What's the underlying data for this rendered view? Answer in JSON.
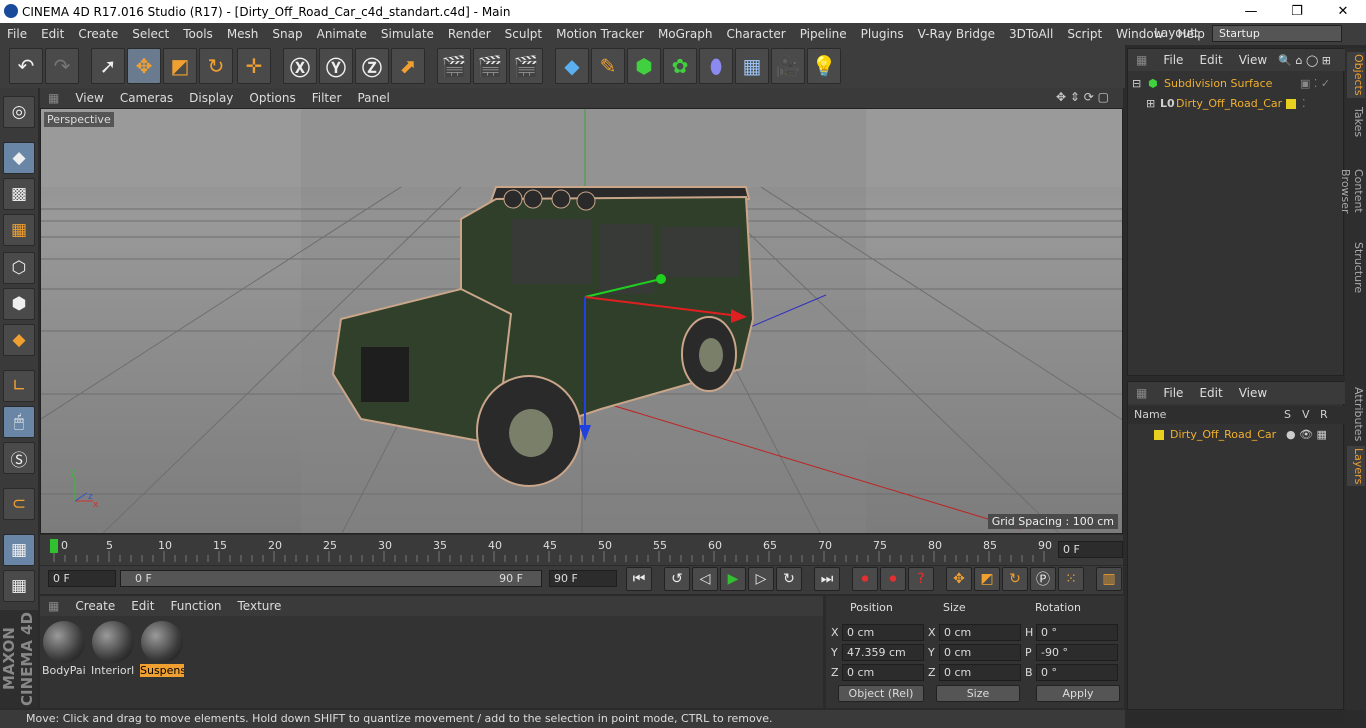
{
  "window": {
    "title": "CINEMA 4D R17.016 Studio (R17) - [Dirty_Off_Road_Car_c4d_standart.c4d] - Main"
  },
  "menu": [
    "File",
    "Edit",
    "Create",
    "Select",
    "Tools",
    "Mesh",
    "Snap",
    "Animate",
    "Simulate",
    "Render",
    "Sculpt",
    "Motion Tracker",
    "MoGraph",
    "Character",
    "Pipeline",
    "Plugins",
    "V-Ray Bridge",
    "3DToAll",
    "Script",
    "Window",
    "Help"
  ],
  "layout": {
    "label": "Layout:",
    "value": "Startup"
  },
  "viewport": {
    "menu": [
      "View",
      "Cameras",
      "Display",
      "Options",
      "Filter",
      "Panel"
    ],
    "camera": "Perspective",
    "grid_spacing": "Grid Spacing : 100 cm"
  },
  "timeline": {
    "ticks": [
      "0",
      "5",
      "10",
      "15",
      "20",
      "25",
      "30",
      "35",
      "40",
      "45",
      "50",
      "55",
      "60",
      "65",
      "70",
      "75",
      "80",
      "85",
      "90"
    ],
    "current": "0 F",
    "start": "0 F",
    "range_start": "0 F",
    "range_end": "90 F",
    "end": "90 F"
  },
  "materials": {
    "menu": [
      "Create",
      "Edit",
      "Function",
      "Texture"
    ],
    "items": [
      {
        "name": "BodyPai",
        "selected": false
      },
      {
        "name": "Interiorl",
        "selected": false
      },
      {
        "name": "Suspens",
        "selected": true
      }
    ]
  },
  "coords": {
    "headers": [
      "Position",
      "Size",
      "Rotation"
    ],
    "position": [
      {
        "axis": "X",
        "value": "0 cm"
      },
      {
        "axis": "Y",
        "value": "47.359 cm"
      },
      {
        "axis": "Z",
        "value": "0 cm"
      }
    ],
    "size": [
      {
        "axis": "X",
        "value": "0 cm"
      },
      {
        "axis": "Y",
        "value": "0 cm"
      },
      {
        "axis": "Z",
        "value": "0 cm"
      }
    ],
    "rotation": [
      {
        "axis": "H",
        "value": "0 °"
      },
      {
        "axis": "P",
        "value": "-90 °"
      },
      {
        "axis": "B",
        "value": "0 °"
      }
    ],
    "mode": "Object (Rel)",
    "size_mode": "Size",
    "apply": "Apply"
  },
  "objects": {
    "menu": [
      "File",
      "Edit",
      "View"
    ],
    "items": [
      {
        "name": "Subdivision Surface",
        "color": "#f0b030"
      },
      {
        "name": "Dirty_Off_Road_Car",
        "color": "#f0b030"
      }
    ]
  },
  "layers": {
    "menu": [
      "File",
      "Edit",
      "View"
    ],
    "columns": [
      "Name",
      "S",
      "V",
      "R"
    ],
    "items": [
      {
        "name": "Dirty_Off_Road_Car",
        "color": "#f0b030"
      }
    ]
  },
  "side_tabs": [
    "Objects",
    "Takes",
    "Content Browser",
    "Structure",
    "Attributes",
    "Layers"
  ],
  "status": "Move: Click and drag to move elements. Hold down SHIFT to quantize movement / add to the selection in point mode, CTRL to remove.",
  "logo": "MAXON CINEMA 4D",
  "colors": {
    "accent": "#f0a030",
    "selected_tool": "#6a86a6"
  }
}
